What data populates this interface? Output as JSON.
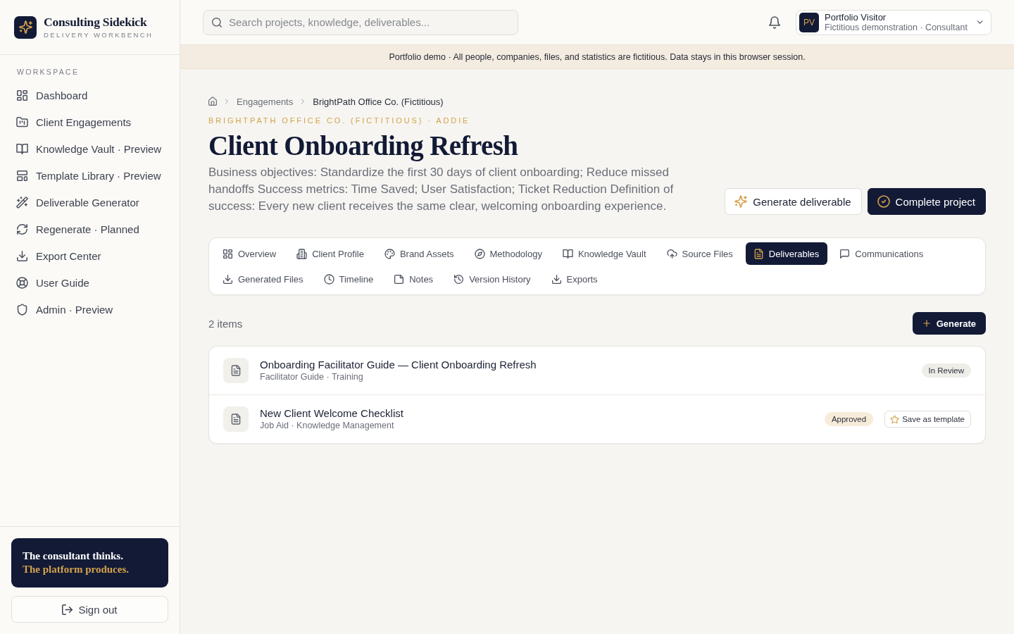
{
  "sidebar": {
    "brand": {
      "name": "Consulting Sidekick",
      "subtitle": "DELIVERY WORKBENCH"
    },
    "section_label": "WORKSPACE",
    "items": [
      {
        "label": "Dashboard",
        "selected": false
      },
      {
        "label": "Client Engagements",
        "selected": false
      },
      {
        "label": "Knowledge Vault · Preview",
        "selected": false
      },
      {
        "label": "Template Library · Preview",
        "selected": false
      },
      {
        "label": "Deliverable Generator",
        "selected": false
      },
      {
        "label": "Regenerate · Planned",
        "selected": false
      },
      {
        "label": "Export Center",
        "selected": false
      },
      {
        "label": "User Guide",
        "selected": false
      },
      {
        "label": "Admin · Preview",
        "selected": false
      }
    ],
    "quote": {
      "line_1": "The consultant thinks.",
      "line_2": "The platform produces."
    },
    "sign_out": "Sign out"
  },
  "topbar": {
    "search": {
      "placeholder": "Search projects, knowledge, deliverables..."
    },
    "user": {
      "initials": "PV",
      "name": "Portfolio Visitor",
      "role": "Fictitious demonstration · Consultant"
    }
  },
  "banner": "Portfolio demo · All people, companies, files, and statistics are fictitious. Data stays in this browser session.",
  "breadcrumb": [
    "Engagements",
    "BrightPath Office Co. (Fictitious)"
  ],
  "header": {
    "eyebrow": "BRIGHTPATH OFFICE CO. (FICTITIOUS) · ADDIE",
    "title": "Client Onboarding Refresh",
    "description": "Business objectives: Standardize the first 30 days of client onboarding; Reduce missed handoffs Success metrics: Time Saved; User Satisfaction; Ticket Reduction Definition of success: Every new client receives the same clear, welcoming onboarding experience.",
    "actions": [
      {
        "label": "Generate deliverable",
        "kind": "secondary"
      },
      {
        "label": "Complete project",
        "kind": "primary"
      }
    ]
  },
  "tabs": [
    {
      "label": "Overview",
      "selected": false
    },
    {
      "label": "Client Profile",
      "selected": false
    },
    {
      "label": "Brand Assets",
      "selected": false
    },
    {
      "label": "Methodology",
      "selected": false
    },
    {
      "label": "Knowledge Vault",
      "selected": false
    },
    {
      "label": "Source Files",
      "selected": false
    },
    {
      "label": "Deliverables",
      "selected": true
    },
    {
      "label": "Communications",
      "selected": false
    },
    {
      "label": "Generated Files",
      "selected": false
    },
    {
      "label": "Timeline",
      "selected": false
    },
    {
      "label": "Notes",
      "selected": false
    },
    {
      "label": "Version History",
      "selected": false
    },
    {
      "label": "Exports",
      "selected": false
    }
  ],
  "deliverables": {
    "count": "2 items",
    "generate_button": "Generate",
    "items": [
      {
        "title": "Onboarding Facilitator Guide — Client Onboarding Refresh",
        "subtitle": "Facilitator Guide · Training",
        "status": {
          "label": "In Review",
          "color": "#efede8"
        }
      },
      {
        "title": "New Client Welcome Checklist",
        "subtitle": "Job Aid · Knowledge Management",
        "status": {
          "label": "Approved",
          "color": "#f7ecd9"
        },
        "action": "Save as template"
      }
    ]
  }
}
